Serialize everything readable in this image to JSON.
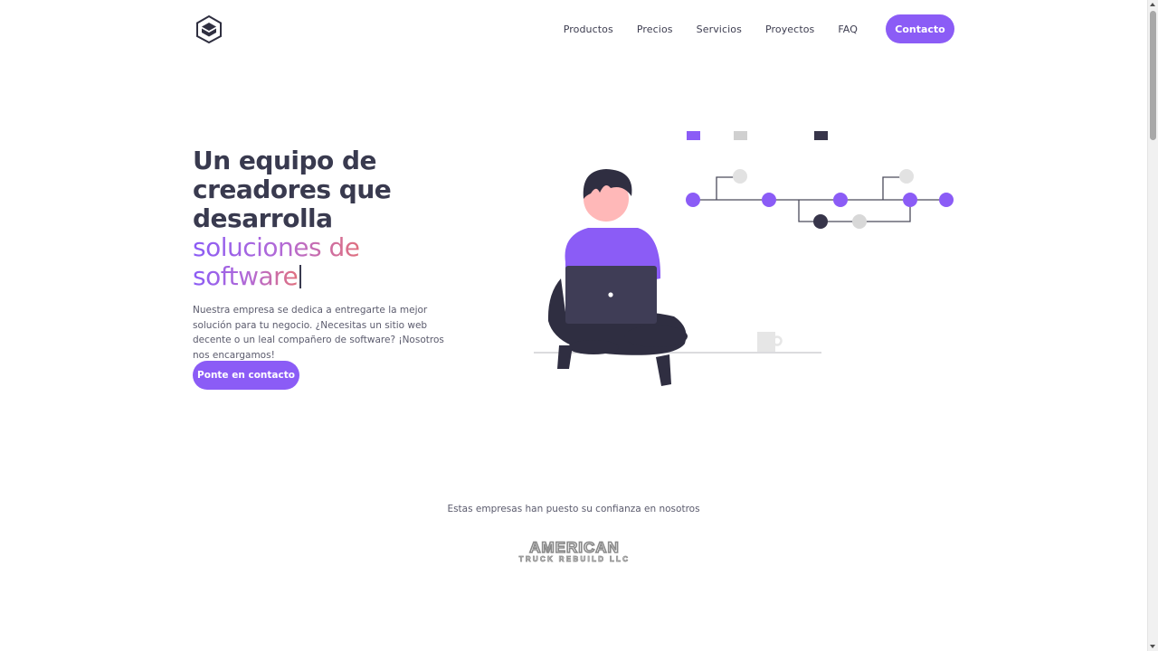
{
  "nav": {
    "items": [
      {
        "label": "Productos"
      },
      {
        "label": "Precios"
      },
      {
        "label": "Servicios"
      },
      {
        "label": "Proyectos"
      },
      {
        "label": "FAQ"
      }
    ],
    "contact_label": "Contacto"
  },
  "hero": {
    "title_line1": "Un equipo de",
    "title_line2": "creadores que",
    "title_line3": "desarrolla",
    "title_highlight_line1": "soluciones de",
    "title_highlight_line2": "software",
    "description": "Nuestra empresa se dedica a entregarte la mejor solución para tu negocio. ¿Necesitas un sitio web decente o un leal compañero de software? ¡Nosotros nos encargamos!",
    "cta_label": "Ponte en contacto"
  },
  "trust": {
    "text": "Estas empresas han puesto su confianza en nosotros",
    "clients": [
      {
        "name_line1": "AMERICAN",
        "name_line2": "TRUCK REBUILD LLC"
      }
    ]
  },
  "colors": {
    "accent": "#8b5cf6",
    "heading": "#393a4f",
    "gradient_end": "#e0707e"
  }
}
